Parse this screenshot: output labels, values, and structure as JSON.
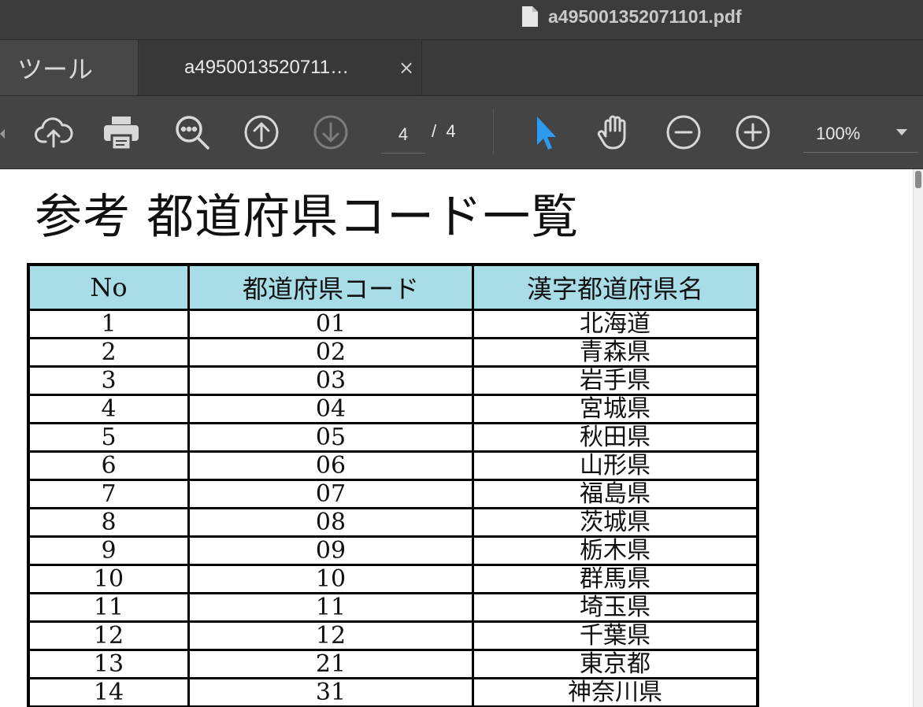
{
  "window": {
    "title": "a495001352071101.pdf"
  },
  "tabs": {
    "tools_label": "ツール",
    "doc_label": "a4950013520711…",
    "close_glyph": "×"
  },
  "toolbar": {
    "page_current": "4",
    "page_total": "/  4",
    "zoom": "100%",
    "icons": [
      "upload-cloud-icon",
      "print-icon",
      "search-icon",
      "page-up-icon",
      "page-down-icon",
      "select-cursor-icon",
      "hand-tool-icon",
      "zoom-out-icon",
      "zoom-in-icon"
    ],
    "accent_color": "#2d9cf0"
  },
  "document": {
    "title": "参考 都道府県コード一覧",
    "table": {
      "headers": [
        "No",
        "都道府県コード",
        "漢字都道府県名"
      ],
      "header_bg": "#a8dce6",
      "rows": [
        [
          "1",
          "01",
          "北海道"
        ],
        [
          "2",
          "02",
          "青森県"
        ],
        [
          "3",
          "03",
          "岩手県"
        ],
        [
          "4",
          "04",
          "宮城県"
        ],
        [
          "5",
          "05",
          "秋田県"
        ],
        [
          "6",
          "06",
          "山形県"
        ],
        [
          "7",
          "07",
          "福島県"
        ],
        [
          "8",
          "08",
          "茨城県"
        ],
        [
          "9",
          "09",
          "栃木県"
        ],
        [
          "10",
          "10",
          "群馬県"
        ],
        [
          "11",
          "11",
          "埼玉県"
        ],
        [
          "12",
          "12",
          "千葉県"
        ],
        [
          "13",
          "21",
          "東京都"
        ],
        [
          "14",
          "31",
          "神奈川県"
        ]
      ]
    }
  }
}
